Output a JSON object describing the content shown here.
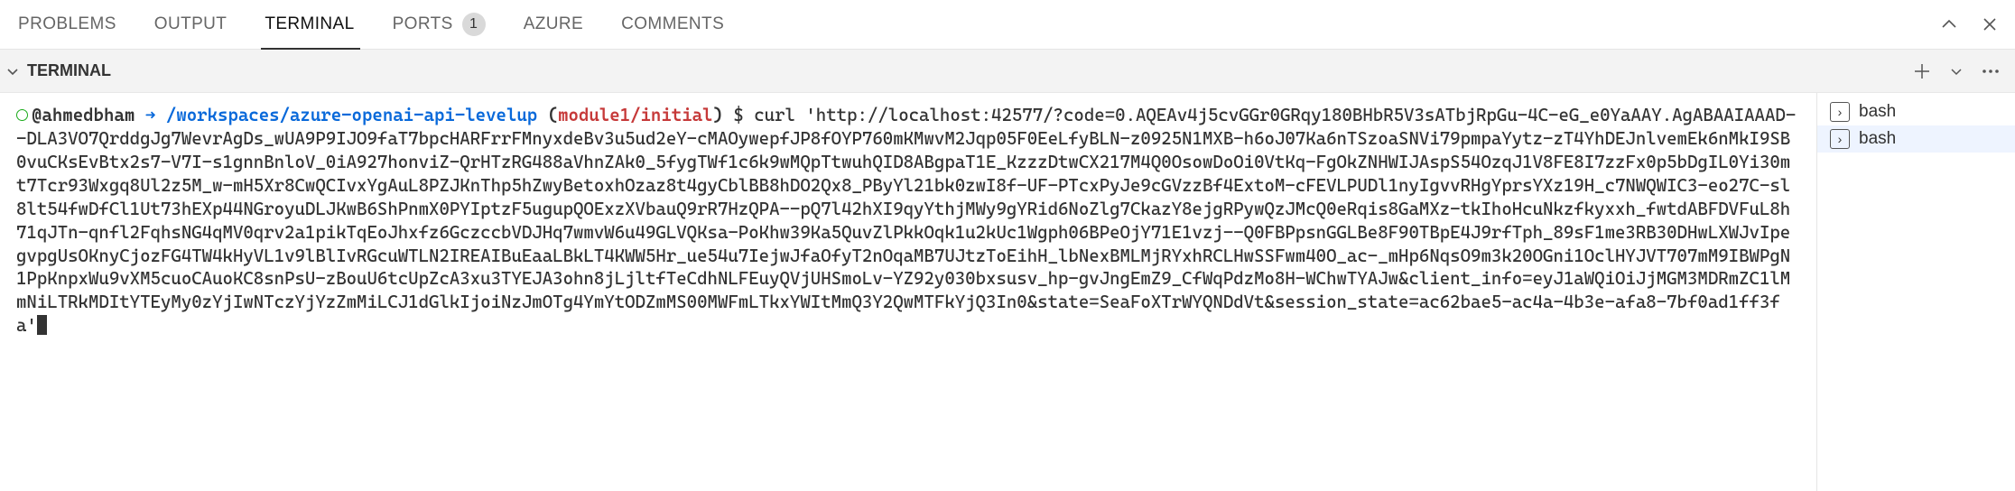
{
  "tabs": {
    "problems": "PROBLEMS",
    "output": "OUTPUT",
    "terminal": "TERMINAL",
    "ports": "PORTS",
    "ports_badge": "1",
    "azure": "AZURE",
    "comments": "COMMENTS"
  },
  "panel": {
    "title": "TERMINAL"
  },
  "prompt": {
    "user": "@ahmedbham",
    "arrow": "➜",
    "path": "/workspaces/azure-openai-api-levelup",
    "branch_open": "(",
    "branch": "module1/initial",
    "branch_close": ")",
    "dollar": "$"
  },
  "command": "curl 'http://localhost:42577/?code=0.AQEAv4j5cvGGr0GRqy180BHbR5V3sATbjRpGu-4C-eG_e0YaAAY.AgABAAIAAAD--DLA3VO7QrddgJg7WevrAgDs_wUA9P9IJO9faT7bpcHARFrrFMnyxdeBv3u5ud2eY-cMAOywepfJP8fOYP760mKMwvM2Jqp05F0EeLfyBLN-z0925N1MXB-h6oJ07Ka6nTSzoaSNVi79pmpaYytz-zT4YhDEJnlvemEk6nMkI9SB0vuCKsEvBtx2s7-V7I-s1gnnBnloV_0iA927honviZ-QrHTzRG488aVhnZAk0_5fygTWf1c6k9wMQpTtwuhQID8ABgpaT1E_KzzzDtwCX217M4Q0OsowDoOi0VtKq-FgOkZNHWIJAspS54OzqJ1V8FE8I7zzFx0p5bDgIL0Yi30mt7Tcr93Wxgq8Ul2z5M_w-mH5Xr8CwQCIvxYgAuL8PZJKnThp5hZwyBetoxhOzaz8t4gyCblBB8hDO2Qx8_PByYl21bk0zwI8f-UF-PTcxPyJe9cGVzzBf4ExtoM-cFEVLPUDl1nyIgvvRHgYprsYXz19H_c7NWQWIC3-eo27C-sl8lt54fwDfCl1Ut73hEXp44NGroyuDLJKwB6ShPnmX0PYIptzF5ugupQOExzXVbauQ9rR7HzQPA--pQ7l42hXI9qyYthjMWy9gYRid6NoZlg7CkazY8ejgRPywQzJMcQ0eRqis8GaMXz-tkIhoHcuNkzfkyxxh_fwtdABFDVFuL8h71qJTn-qnfl2FqhsNG4qMV0qrv2a1pikTqEoJhxfz6GczccbVDJHq7wmvW6u49GLVQKsa-PoKhw39Ka5QuvZlPkkOqk1u2kUc1Wgph06BPeOjY71E1vzj--Q0FBPpsnGGLBe8F90TBpE4J9rfTph_89sF1me3RB30DHwLXWJvIpegvpgUsOKnyCjozFG4TW4kHyVL1v9lBlIvRGcuWTLN2IREAIBuEaaLBkLT4KWW5Hr_ue54u7IejwJfaOfyT2nOqaMB7UJtzToEihH_lbNexBMLMjRYxhRCLHwSSFwm40O_ac-_mHp6NqsO9m3k20OGni1OclHYJVT707mM9IBWPgN1PpKnpxWu9vXM5cuoCAuoKC8snPsU-zBouU6tcUpZcA3xu3TYEJA3ohn8jLjltfTeCdhNLFEuyQVjUHSmoLv-YZ92y030bxsusv_hp-gvJngEmZ9_CfWqPdzMo8H-WChwTYAJw&client_info=eyJ1aWQiOiJjMGM3MDRmZC1lMmNiLTRkMDItYTEyMy0zYjIwNTczYjYzZmMiLCJ1dGlkIjoiNzJmOTg4YmYtODZmMS00MWFmLTkxYWItMmQ3Y2QwMTFkYjQ3In0&state=SeaFoXTrWYQNDdVt&session_state=ac62bae5-ac4a-4b3e-afa8-7bf0ad1ff3fa'",
  "side": {
    "items": [
      "bash",
      "bash"
    ],
    "selected": 1
  }
}
